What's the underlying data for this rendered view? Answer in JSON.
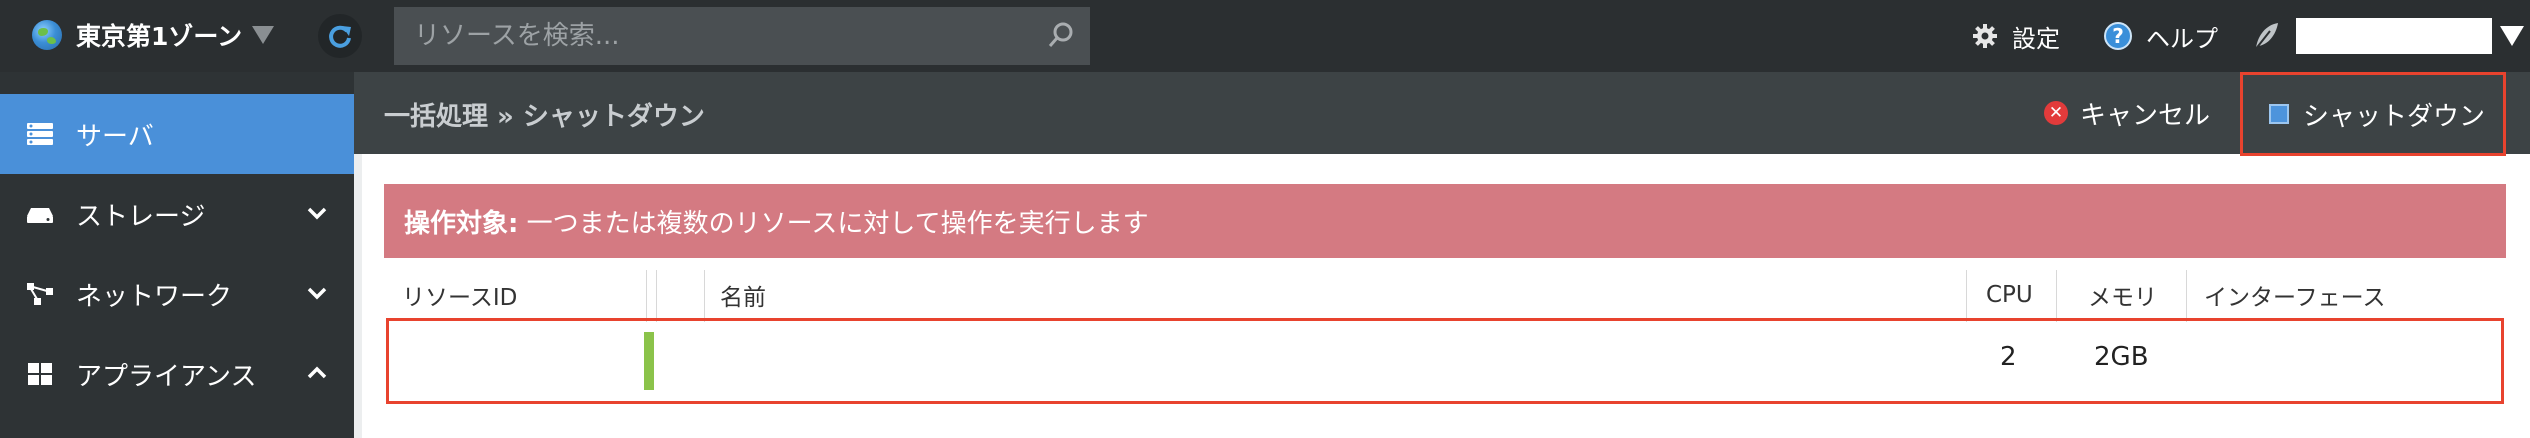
{
  "header": {
    "zone": "東京第1ゾーン",
    "search_placeholder": "リソースを検索...",
    "settings_label": "設定",
    "help_label": "ヘルプ"
  },
  "sidebar": {
    "items": [
      {
        "label": "サーバ",
        "icon": "server-icon",
        "active": true
      },
      {
        "label": "ストレージ",
        "icon": "storage-icon",
        "expanded": false
      },
      {
        "label": "ネットワーク",
        "icon": "network-icon",
        "expanded": false
      },
      {
        "label": "アプライアンス",
        "icon": "appliance-icon",
        "expanded": true
      }
    ]
  },
  "page": {
    "breadcrumb": "一括処理 » シャットダウン",
    "cancel_label": "キャンセル",
    "shutdown_label": "シャットダウン"
  },
  "alert": {
    "bold": "操作対象:",
    "text": " 一つまたは複数のリソースに対して操作を実行します",
    "color": "#d47a82"
  },
  "table": {
    "columns": [
      "リソースID",
      "",
      "",
      "名前",
      "CPU",
      "メモリ",
      "インターフェース"
    ],
    "rows": [
      {
        "resource_id": "",
        "status_color": "#8bc34a",
        "name": "",
        "cpu": "2",
        "memory": "2GB",
        "interfaces": ""
      }
    ]
  },
  "colors": {
    "accent": "#4a90d9",
    "highlight": "#e8432e",
    "topbar": "#2b2f31"
  }
}
